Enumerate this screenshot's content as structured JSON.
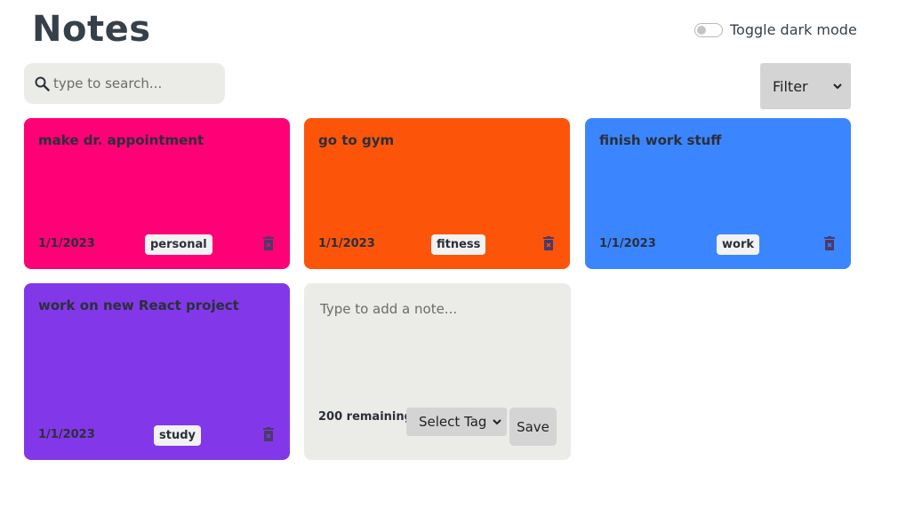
{
  "header": {
    "title": "Notes",
    "dark_mode_label": "Toggle dark mode",
    "dark_mode_on": false
  },
  "search": {
    "placeholder": "type to search...",
    "value": ""
  },
  "filter": {
    "label": "Filter"
  },
  "notes": [
    {
      "text": "make dr. appointment",
      "date": "1/1/2023",
      "tag": "personal",
      "color": "#ff0076"
    },
    {
      "text": "go to gym",
      "date": "1/1/2023",
      "tag": "fitness",
      "color": "#fc550a"
    },
    {
      "text": "finish work stuff",
      "date": "1/1/2023",
      "tag": "work",
      "color": "#3b86ff"
    },
    {
      "text": "work on new React project",
      "date": "1/1/2023",
      "tag": "study",
      "color": "#8238e8"
    }
  ],
  "new_note": {
    "placeholder": "Type to add a note...",
    "remaining": "200 remaining",
    "tag_select_label": "Select Tag",
    "save_label": "Save"
  },
  "colors": {
    "new_note_bg": "#ebebe8",
    "text": "#2b2f3a",
    "delete_icon": "#4a3a6a"
  }
}
